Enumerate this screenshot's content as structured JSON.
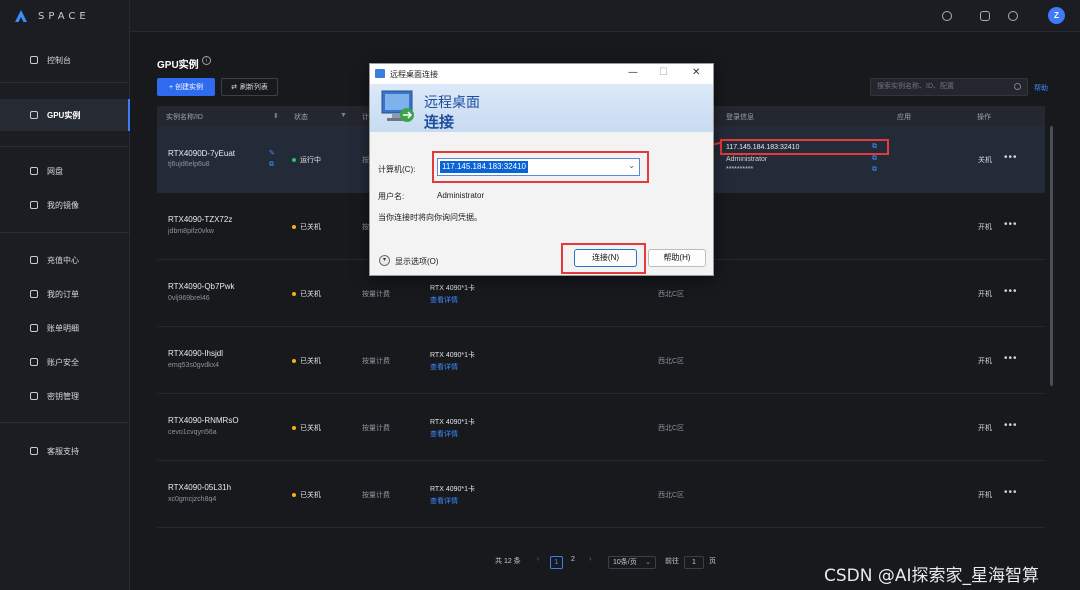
{
  "app": {
    "brand": "SPACE"
  },
  "sidebar": {
    "items": [
      {
        "label": "控制台",
        "icon": "home-icon"
      },
      {
        "label": "GPU实例",
        "icon": "gpu-icon",
        "active": true
      },
      {
        "label": "网盘",
        "icon": "disk-icon"
      },
      {
        "label": "我的镜像",
        "icon": "image-icon"
      },
      {
        "label": "充值中心",
        "icon": "wallet-icon"
      },
      {
        "label": "我的订单",
        "icon": "order-icon"
      },
      {
        "label": "账单明细",
        "icon": "bill-icon"
      },
      {
        "label": "账户安全",
        "icon": "shield-icon"
      },
      {
        "label": "密钥管理",
        "icon": "key-icon"
      },
      {
        "label": "客服支持",
        "icon": "chat-icon"
      }
    ]
  },
  "topbar": {
    "avatar_letter": "Z"
  },
  "page": {
    "title": "GPU实例",
    "create_button": "+ 创建实例",
    "refresh_button": "刷新列表",
    "search_placeholder": "搜索实例名称、ID、配置",
    "help": "帮助"
  },
  "table": {
    "columns": [
      "实例名称/ID",
      "状态",
      "计",
      "",
      "",
      "",
      "登录信息",
      "应用",
      "操作"
    ],
    "rows": [
      {
        "name": "RTX4090D-7yEuat",
        "id": "tj6ujd6elp6u8",
        "status": "运行中",
        "status_color": "#22c55e",
        "billing": "按",
        "spec": "",
        "detail": "",
        "region": "",
        "login_host": "117.145.184.183:32410",
        "login_user": "Administrator",
        "login_pass": "**********",
        "action": "关机"
      },
      {
        "name": "RTX4090-TZX72z",
        "id": "jdbm8pifz0vkw",
        "status": "已关机",
        "status_color": "#f5b20b",
        "billing": "按",
        "spec": "",
        "detail": "",
        "region": "",
        "action": "开机"
      },
      {
        "name": "RTX4090-Qb7Pwk",
        "id": "0vlj969brel46",
        "status": "已关机",
        "status_color": "#f5b20b",
        "billing": "按量计费",
        "spec": "RTX 4090*1卡",
        "detail": "查看详情",
        "region": "西北C区",
        "action": "开机"
      },
      {
        "name": "RTX4090-Ihsjdl",
        "id": "emq53s0gvdkx4",
        "status": "已关机",
        "status_color": "#f5b20b",
        "billing": "按量计费",
        "spec": "RTX 4090*1卡",
        "detail": "查看详情",
        "region": "西北C区",
        "action": "开机"
      },
      {
        "name": "RTX4090-RNMRsO",
        "id": "cevo1cvqyn56a",
        "status": "已关机",
        "status_color": "#f5b20b",
        "billing": "按量计费",
        "spec": "RTX 4090*1卡",
        "detail": "查看详情",
        "region": "西北C区",
        "action": "开机"
      },
      {
        "name": "RTX4090-05L31h",
        "id": "xc0gmcjzch8q4",
        "status": "已关机",
        "status_color": "#f5b20b",
        "billing": "按量计费",
        "spec": "RTX 4090*1卡",
        "detail": "查看详情",
        "region": "西北C区",
        "action": "开机"
      }
    ]
  },
  "pagination": {
    "total": "共 12 条",
    "pages": [
      "1",
      "2"
    ],
    "current": "1",
    "page_size": "10条/页",
    "goto_label": "前往",
    "goto_value": "1",
    "page_unit": "页"
  },
  "dialog": {
    "title": "远程桌面连接",
    "banner_line1": "远程桌面",
    "banner_line2": "连接",
    "computer_label": "计算机(C):",
    "computer_value": "117.145.184.183:32410",
    "username_label": "用户名:",
    "username_value": "Administrator",
    "note": "当你连接时将向你询问凭据。",
    "options_label": "显示选项(O)",
    "connect_button": "连接(N)",
    "help_button": "帮助(H)"
  },
  "watermark": "CSDN @AI探索家_星海智算"
}
